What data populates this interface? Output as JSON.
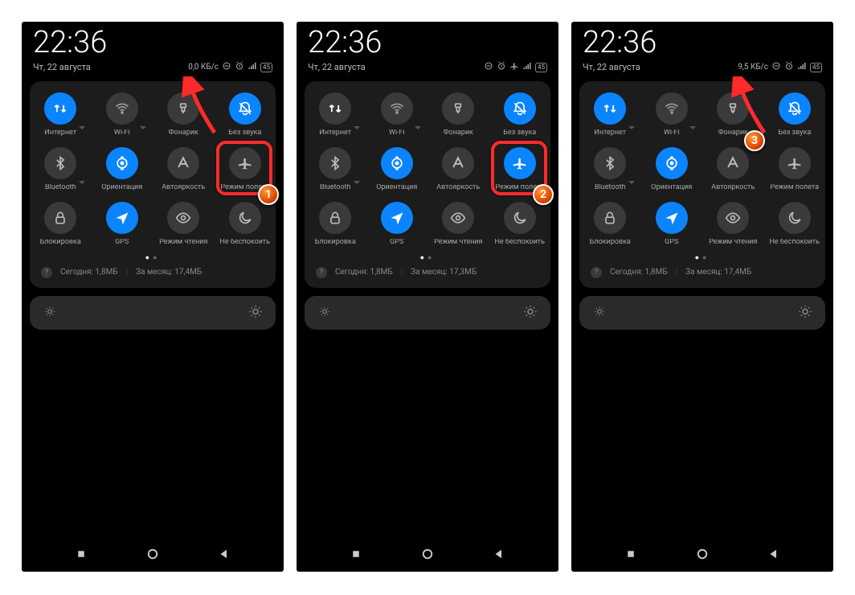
{
  "screens": [
    {
      "time": "22:36",
      "date": "Чт, 22 августа",
      "net_speed": "0,0 КБ/с",
      "battery": "45",
      "airplane_in_status": false,
      "tiles": [
        {
          "id": "internet",
          "label": "Интернет",
          "active": true,
          "icon": "data",
          "caret": true
        },
        {
          "id": "wifi",
          "label": "Wi-Fi",
          "active": false,
          "icon": "wifi",
          "caret": true
        },
        {
          "id": "flashlight",
          "label": "Фонарик",
          "active": false,
          "icon": "flash",
          "caret": false
        },
        {
          "id": "mute",
          "label": "Без звука",
          "active": true,
          "icon": "mute",
          "caret": false
        },
        {
          "id": "bluetooth",
          "label": "Bluetooth",
          "active": false,
          "icon": "bt",
          "caret": true
        },
        {
          "id": "rotation",
          "label": "Ориентация",
          "active": true,
          "icon": "rotate",
          "caret": false
        },
        {
          "id": "autobright",
          "label": "Автояркость",
          "active": false,
          "icon": "autobr",
          "caret": false
        },
        {
          "id": "airplane",
          "label": "Режим полета",
          "active": false,
          "icon": "airplane",
          "caret": false
        },
        {
          "id": "lock",
          "label": "Блокировка",
          "active": false,
          "icon": "lock",
          "caret": false
        },
        {
          "id": "gps",
          "label": "GPS",
          "active": true,
          "icon": "gps",
          "caret": false
        },
        {
          "id": "reading",
          "label": "Режим чтения",
          "active": false,
          "icon": "eye",
          "caret": false
        },
        {
          "id": "dnd",
          "label": "Не беспокоить",
          "active": false,
          "icon": "moon",
          "caret": false
        }
      ],
      "usage_today_label": "Сегодня: 1,8МБ",
      "usage_month_label": "За месяц: 17,4МБ",
      "highlight": {
        "tile_index": 7,
        "marker": "1",
        "arrow_to_statusbar": true
      }
    },
    {
      "time": "22:36",
      "date": "Чт, 22 августа",
      "net_speed": "",
      "battery": "45",
      "airplane_in_status": true,
      "tiles": [
        {
          "id": "internet",
          "label": "Интернет",
          "active": false,
          "icon": "data",
          "caret": true
        },
        {
          "id": "wifi",
          "label": "Wi-Fi",
          "active": false,
          "icon": "wifi",
          "caret": true
        },
        {
          "id": "flashlight",
          "label": "Фонарик",
          "active": false,
          "icon": "flash",
          "caret": false
        },
        {
          "id": "mute",
          "label": "Без звука",
          "active": true,
          "icon": "mute",
          "caret": false
        },
        {
          "id": "bluetooth",
          "label": "Bluetooth",
          "active": false,
          "icon": "bt",
          "caret": true
        },
        {
          "id": "rotation",
          "label": "Ориентация",
          "active": true,
          "icon": "rotate",
          "caret": false
        },
        {
          "id": "autobright",
          "label": "Автояркость",
          "active": false,
          "icon": "autobr",
          "caret": false
        },
        {
          "id": "airplane",
          "label": "Режим полета",
          "active": true,
          "icon": "airplane",
          "caret": false
        },
        {
          "id": "lock",
          "label": "Блокировка",
          "active": false,
          "icon": "lock",
          "caret": false
        },
        {
          "id": "gps",
          "label": "GPS",
          "active": true,
          "icon": "gps",
          "caret": false
        },
        {
          "id": "reading",
          "label": "Режим чтения",
          "active": false,
          "icon": "eye",
          "caret": false
        },
        {
          "id": "dnd",
          "label": "Не беспокоить",
          "active": false,
          "icon": "moon",
          "caret": false
        }
      ],
      "usage_today_label": "Сегодня: 1,8МБ",
      "usage_month_label": "За месяц: 17,3МБ",
      "highlight": {
        "tile_index": 7,
        "marker": "2",
        "arrow_to_statusbar": false
      }
    },
    {
      "time": "22:36",
      "date": "Чт, 22 августа",
      "net_speed": "9,5 КБ/с",
      "battery": "45",
      "airplane_in_status": false,
      "tiles": [
        {
          "id": "internet",
          "label": "Интернет",
          "active": true,
          "icon": "data",
          "caret": true
        },
        {
          "id": "wifi",
          "label": "Wi-Fi",
          "active": false,
          "icon": "wifi",
          "caret": true
        },
        {
          "id": "flashlight",
          "label": "Фонарик",
          "active": false,
          "icon": "flash",
          "caret": false
        },
        {
          "id": "mute",
          "label": "Без звука",
          "active": true,
          "icon": "mute",
          "caret": false
        },
        {
          "id": "bluetooth",
          "label": "Bluetooth",
          "active": false,
          "icon": "bt",
          "caret": true
        },
        {
          "id": "rotation",
          "label": "Ориентация",
          "active": true,
          "icon": "rotate",
          "caret": false
        },
        {
          "id": "autobright",
          "label": "Автояркость",
          "active": false,
          "icon": "autobr",
          "caret": false
        },
        {
          "id": "airplane",
          "label": "Режим полета",
          "active": false,
          "icon": "airplane",
          "caret": false
        },
        {
          "id": "lock",
          "label": "Блокировка",
          "active": false,
          "icon": "lock",
          "caret": false
        },
        {
          "id": "gps",
          "label": "GPS",
          "active": true,
          "icon": "gps",
          "caret": false
        },
        {
          "id": "reading",
          "label": "Режим чтения",
          "active": false,
          "icon": "eye",
          "caret": false
        },
        {
          "id": "dnd",
          "label": "Не беспокоить",
          "active": false,
          "icon": "moon",
          "caret": false
        }
      ],
      "usage_today_label": "Сегодня: 1,8МБ",
      "usage_month_label": "За месяц: 17,4МБ",
      "highlight": {
        "tile_index": null,
        "marker": "3",
        "arrow_to_statusbar": true
      }
    }
  ]
}
